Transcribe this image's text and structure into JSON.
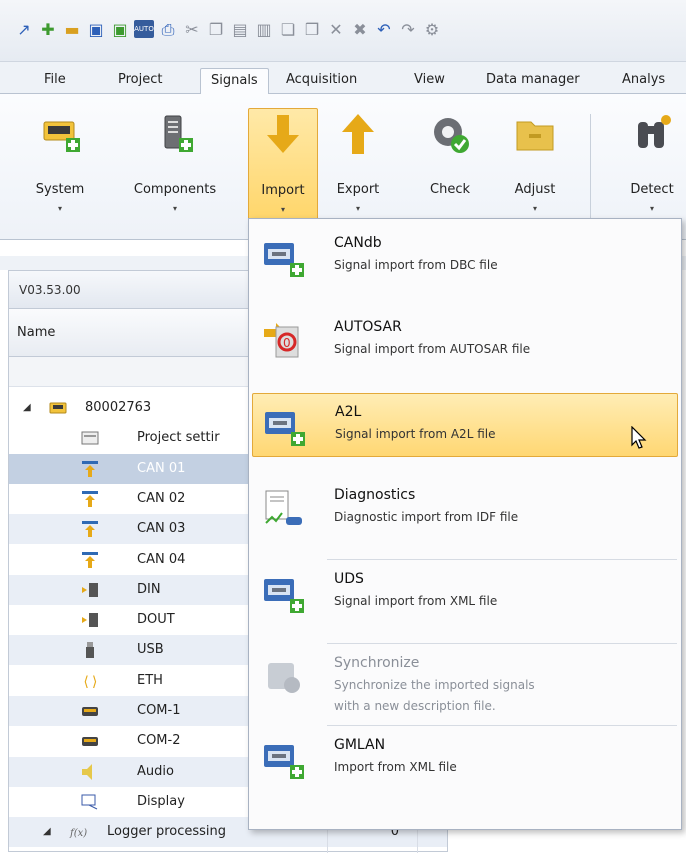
{
  "toolbar": {
    "quick_access": [
      "open-icon",
      "new-icon",
      "folder-icon",
      "save-icon",
      "save-as-icon",
      "auto-icon",
      "print-icon",
      "cut-icon",
      "copy-icon",
      "paste-icon",
      "paste-special-icon",
      "copy-doc-icon",
      "copy-page-icon",
      "delete-icon",
      "delete-all-icon",
      "undo-icon",
      "redo-icon",
      "settings-icon"
    ],
    "quick_access_auto_label": "AUTO"
  },
  "menu_tabs": [
    "File",
    "Project",
    "Signals",
    "Acquisition",
    "View",
    "Data manager",
    "Analys"
  ],
  "active_tab": "Signals",
  "ribbon": {
    "buttons": [
      {
        "label": "System",
        "icon": "system-icon"
      },
      {
        "label": "Components",
        "icon": "components-icon"
      },
      {
        "label": "Import",
        "icon": "import-icon",
        "active": true
      },
      {
        "label": "Export",
        "icon": "export-icon"
      },
      {
        "label": "Check",
        "icon": "check-icon"
      },
      {
        "label": "Adjust",
        "icon": "adjust-icon"
      },
      {
        "label": "Detect",
        "icon": "detect-icon"
      }
    ],
    "dropdown_marker": "▾"
  },
  "panel": {
    "version": "V03.53.00",
    "column_name": "Name",
    "tree": [
      {
        "label": "80002763",
        "icon": "device-icon",
        "level": 0,
        "expanded": true
      },
      {
        "label": "Project settir",
        "icon": "project-settings-icon",
        "level": 1
      },
      {
        "label": "CAN 01",
        "icon": "can-icon",
        "level": 1,
        "selected": true
      },
      {
        "label": "CAN 02",
        "icon": "can-icon",
        "level": 1
      },
      {
        "label": "CAN 03",
        "icon": "can-icon",
        "level": 1
      },
      {
        "label": "CAN 04",
        "icon": "can-icon",
        "level": 1
      },
      {
        "label": "DIN",
        "icon": "din-icon",
        "level": 1
      },
      {
        "label": "DOUT",
        "icon": "dout-icon",
        "level": 1
      },
      {
        "label": "USB",
        "icon": "usb-icon",
        "level": 1
      },
      {
        "label": "ETH",
        "icon": "eth-icon",
        "level": 1
      },
      {
        "label": "COM-1",
        "icon": "com-icon",
        "level": 1
      },
      {
        "label": "COM-2",
        "icon": "com-icon",
        "level": 1
      },
      {
        "label": "Audio",
        "icon": "audio-icon",
        "level": 1
      },
      {
        "label": "Display",
        "icon": "display-icon",
        "level": 1
      },
      {
        "label": "Logger processing",
        "icon": "logger-icon",
        "level": 0,
        "expanded": true,
        "value": "0"
      }
    ]
  },
  "import_menu": {
    "items": [
      {
        "title": "CANdb",
        "desc": "Signal import from DBC file",
        "icon": "candb-icon"
      },
      {
        "title": "AUTOSAR",
        "desc": "Signal import from AUTOSAR file",
        "icon": "autosar-icon"
      },
      {
        "title": "A2L",
        "desc": "Signal import from A2L file",
        "icon": "a2l-icon",
        "highlighted": true
      },
      {
        "title": "Diagnostics",
        "desc": "Diagnostic import from IDF file",
        "icon": "diagnostics-icon"
      },
      {
        "title": "UDS",
        "desc": "Signal import from XML file",
        "icon": "uds-icon"
      },
      {
        "title": "Synchronize",
        "desc": "Synchronize the imported signals",
        "desc2": "with a new description file.",
        "icon": "synchronize-icon",
        "disabled": true
      },
      {
        "title": "GMLAN",
        "desc": "Import from XML file",
        "icon": "gmlan-icon"
      }
    ]
  },
  "colors": {
    "highlight": "#ffd773",
    "accent": "#e3a93a",
    "selection": "#c3d0e2"
  }
}
